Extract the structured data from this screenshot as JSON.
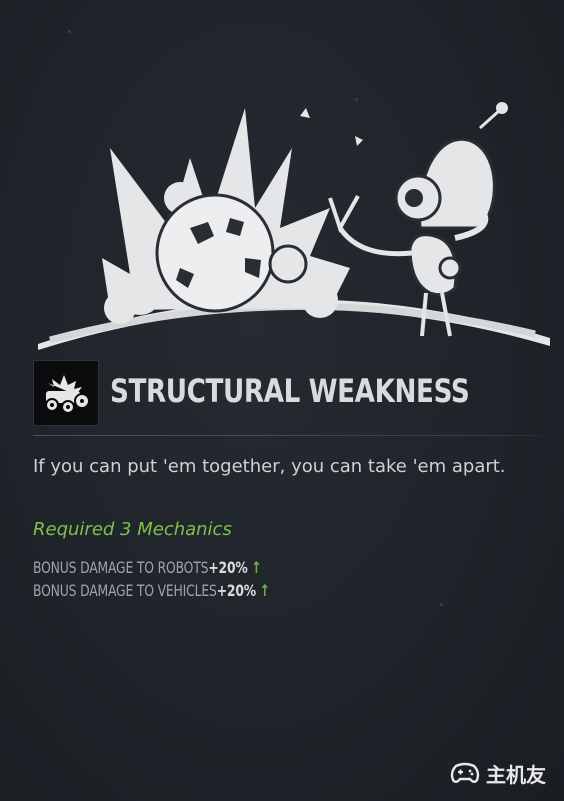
{
  "perk": {
    "title": "STRUCTURAL WEAKNESS",
    "description": "If you can put 'em together, you can take 'em apart.",
    "requirement": "Required 3 Mechanics",
    "bonuses": [
      {
        "label": "BONUS DAMAGE TO ROBOTS",
        "value": "+20%"
      },
      {
        "label": "BONUS DAMAGE TO VEHICLES",
        "value": "+20%"
      }
    ],
    "icons": {
      "hero": "robot-explosion-illustration",
      "badge": "wrecked-vehicles-icon",
      "bonus": "up-arrow-icon"
    }
  },
  "watermark": {
    "text": "主机友",
    "icon": "gamepad-logo"
  },
  "colors": {
    "background": "#1f242a",
    "requirement": "#7fc04a",
    "arrow": "#6fae48",
    "title": "#d9dbdd"
  }
}
